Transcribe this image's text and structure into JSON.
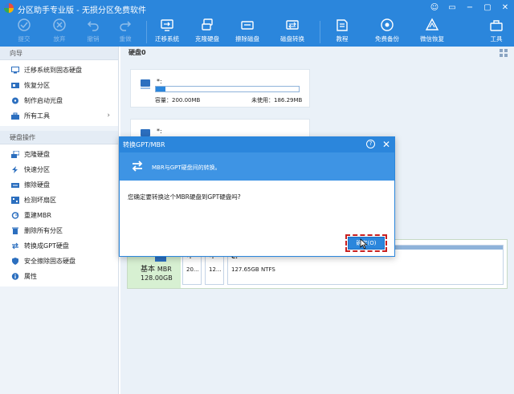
{
  "window": {
    "title": "分区助手专业版 - 无损分区免费软件",
    "controls": [
      "☺",
      "▭",
      "−",
      "▢",
      "✕"
    ]
  },
  "toolbar": {
    "commit": "提交",
    "discard": "放弃",
    "undo": "撤销",
    "redo": "重做",
    "migrate_os": "迁移系统",
    "clone_disk": "克隆硬盘",
    "wipe_disk": "擦除磁盘",
    "disk_convert": "磁盘转换",
    "tutorial": "教程",
    "free_backup": "免费备份",
    "wechat_recovery": "微信恢复",
    "tools": "工具"
  },
  "sidebar": {
    "wizard_header": "向导",
    "wizard_items": [
      {
        "label": "迁移系统到固态硬盘",
        "icon": "migrate-icon"
      },
      {
        "label": "恢复分区",
        "icon": "restore-icon"
      },
      {
        "label": "制作启动光盘",
        "icon": "bootdisk-icon"
      },
      {
        "label": "所有工具",
        "icon": "tools-icon"
      }
    ],
    "disk_ops_header": "硬盘操作",
    "disk_items": [
      {
        "label": "克隆硬盘",
        "icon": "clone-icon"
      },
      {
        "label": "快速分区",
        "icon": "lightning-icon"
      },
      {
        "label": "擦除硬盘",
        "icon": "wipe-icon"
      },
      {
        "label": "检测坏扇区",
        "icon": "scan-icon"
      },
      {
        "label": "重建MBR",
        "icon": "rebuild-icon"
      },
      {
        "label": "删除所有分区",
        "icon": "delete-icon"
      },
      {
        "label": "转换成GPT硬盘",
        "icon": "convert-icon"
      },
      {
        "label": "安全擦除固态硬盘",
        "icon": "shield-icon"
      },
      {
        "label": "属性",
        "icon": "info-icon"
      }
    ]
  },
  "main": {
    "disk_header": "硬盘0",
    "partitions": [
      {
        "name": "*:",
        "capacity": "容量：200.00MB",
        "unused": "未使用：186.29MB",
        "used_fraction": 0.07
      },
      {
        "name": "*:"
      }
    ],
    "disk_map": {
      "type": "基本",
      "style": "MBR",
      "size": "128.00GB",
      "segments": [
        {
          "name": "*:",
          "info": "20..."
        },
        {
          "name": "*:",
          "info": "12..."
        },
        {
          "name": "C:",
          "info": "127.65GB NTFS"
        }
      ]
    }
  },
  "dialog": {
    "title": "转换GPT/MBR",
    "help": "?",
    "banner": "MBR与GPT硬盘间的转换。",
    "message": "您确定要转换这个MBR硬盘到GPT硬盘吗?",
    "ok": "确定(O)"
  },
  "colors": {
    "accent": "#2b86dc",
    "highlight": "#c81e1e"
  }
}
